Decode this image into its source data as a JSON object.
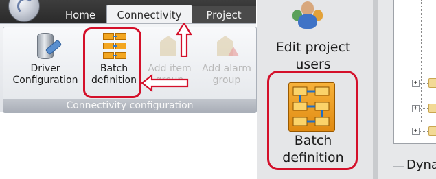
{
  "ribbon": {
    "tabs": [
      {
        "label": "Home"
      },
      {
        "label": "Connectivity",
        "active": true
      },
      {
        "label": "Project"
      }
    ],
    "group": {
      "caption": "Connectivity configuration",
      "buttons": [
        {
          "line1": "Driver",
          "line2": "Configuration",
          "icon": "database-wrench-icon",
          "enabled": true
        },
        {
          "line1": "Batch",
          "line2": "definition",
          "icon": "batch-flow-icon",
          "enabled": true
        },
        {
          "line1": "Add item",
          "line2": "group",
          "icon": "tag-icon",
          "enabled": false
        },
        {
          "line1": "Add alarm",
          "line2": "group",
          "icon": "alarm-tag-icon",
          "enabled": false
        }
      ]
    }
  },
  "side_panel": {
    "edit_users": {
      "line1": "Edit project",
      "line2": "users",
      "icon": "users-icon"
    },
    "batch": {
      "line1": "Batch",
      "line2": "definition",
      "icon": "batch-flow-icon"
    }
  },
  "tree": {
    "expanders": [
      "+",
      "+",
      "+"
    ],
    "section_label": "Dyna"
  },
  "annotations": {
    "color": "#d4102a"
  }
}
